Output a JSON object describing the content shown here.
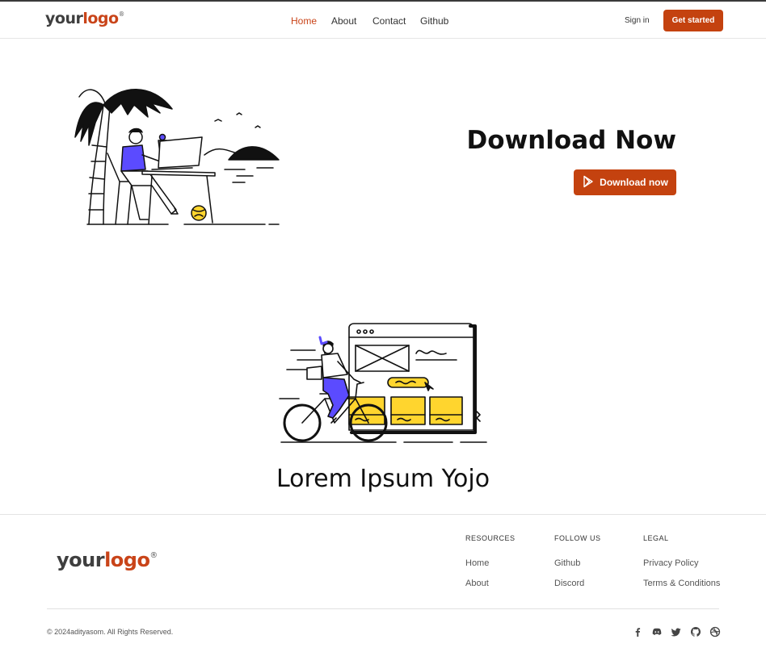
{
  "header": {
    "logo": {
      "your": "your",
      "logo": "logo",
      "mark": "®"
    },
    "nav": [
      {
        "label": "Home",
        "active": true
      },
      {
        "label": "About",
        "active": false
      },
      {
        "label": "Contact",
        "active": false
      },
      {
        "label": "Github",
        "active": false
      }
    ],
    "sign_in": "Sign in",
    "get_started": "Get started"
  },
  "hero": {
    "title": "Download Now",
    "download_button": "Download now",
    "download_icon": "play-store-icon",
    "illustration": "beach-laptop-illustration"
  },
  "section": {
    "title": "Lorem Ipsum Yojo",
    "illustration": "bike-website-illustration"
  },
  "footer": {
    "logo": {
      "your": "your",
      "logo": "logo",
      "mark": "®"
    },
    "columns": [
      {
        "heading": "RESOURCES",
        "links": [
          "Home",
          "About"
        ]
      },
      {
        "heading": "FOLLOW US",
        "links": [
          "Github",
          "Discord"
        ]
      },
      {
        "heading": "LEGAL",
        "links": [
          "Privacy Policy",
          "Terms & Conditions"
        ]
      }
    ],
    "copyright": "© 2024adityasom. All Rights Reserved.",
    "social_icons": [
      "facebook-icon",
      "discord-icon",
      "twitter-icon",
      "github-icon",
      "dribbble-icon"
    ]
  },
  "colors": {
    "accent": "#c4420f",
    "text": "#111111",
    "purple": "#5b4bff",
    "yellow": "#ffd52e"
  }
}
